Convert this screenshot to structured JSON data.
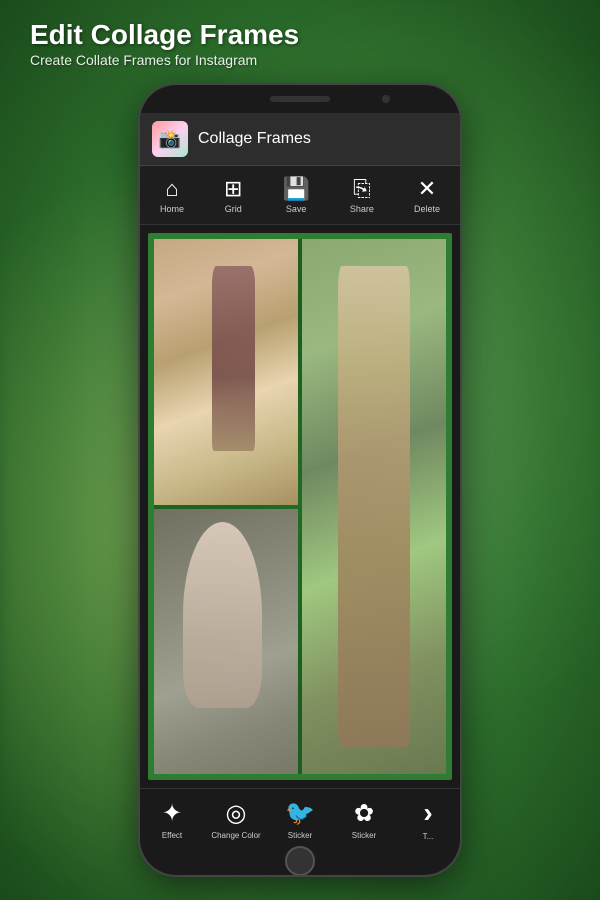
{
  "page": {
    "title_main": "Edit Collage Frames",
    "title_sub": "Create Collate Frames for Instagram"
  },
  "app": {
    "name": "Collage Frames"
  },
  "toolbar": {
    "items": [
      {
        "id": "home",
        "label": "Home",
        "icon": "⌂"
      },
      {
        "id": "grid",
        "label": "Grid",
        "icon": "⊞"
      },
      {
        "id": "save",
        "label": "Save",
        "icon": "💾"
      },
      {
        "id": "share",
        "label": "Share",
        "icon": "⎘"
      },
      {
        "id": "delete",
        "label": "Delete",
        "icon": "✕"
      }
    ]
  },
  "bottom_bar": {
    "items": [
      {
        "id": "effect",
        "label": "Effect",
        "icon": "✦"
      },
      {
        "id": "change_color",
        "label": "Change Color",
        "icon": "◎"
      },
      {
        "id": "sticker1",
        "label": "Sticker",
        "icon": "🐦"
      },
      {
        "id": "sticker2",
        "label": "Sticker",
        "icon": "✿"
      },
      {
        "id": "next",
        "label": "T...",
        "icon": "›"
      }
    ]
  }
}
